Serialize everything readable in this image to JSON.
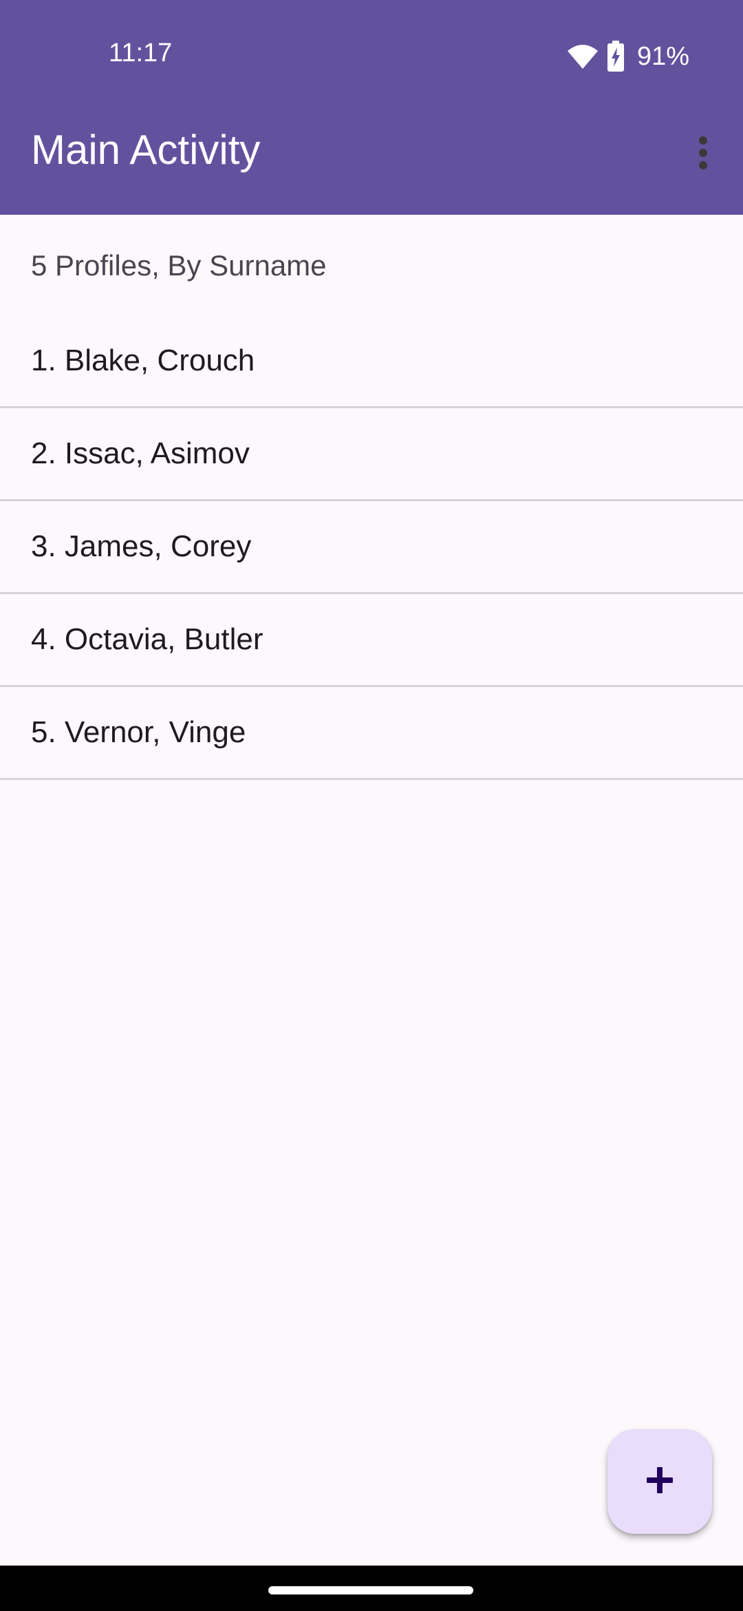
{
  "status_bar": {
    "time": "11:17",
    "battery_percent": "91%",
    "icons": [
      "wifi-icon",
      "battery-charging-icon"
    ]
  },
  "app_bar": {
    "title": "Main Activity",
    "overflow_icon": "more-vert-icon"
  },
  "list": {
    "header": "5 Profiles, By Surname",
    "items": [
      {
        "label": "1. Blake, Crouch"
      },
      {
        "label": "2. Issac, Asimov"
      },
      {
        "label": "3. James, Corey"
      },
      {
        "label": "4. Octavia, Butler"
      },
      {
        "label": "5. Vernor, Vinge"
      }
    ]
  },
  "fab": {
    "icon": "add-icon"
  },
  "colors": {
    "app_bar": "#62529E",
    "background": "#FCF8FC",
    "fab_background": "#E9DDFB",
    "fab_icon": "#21005D",
    "divider": "#D6D2D8"
  }
}
